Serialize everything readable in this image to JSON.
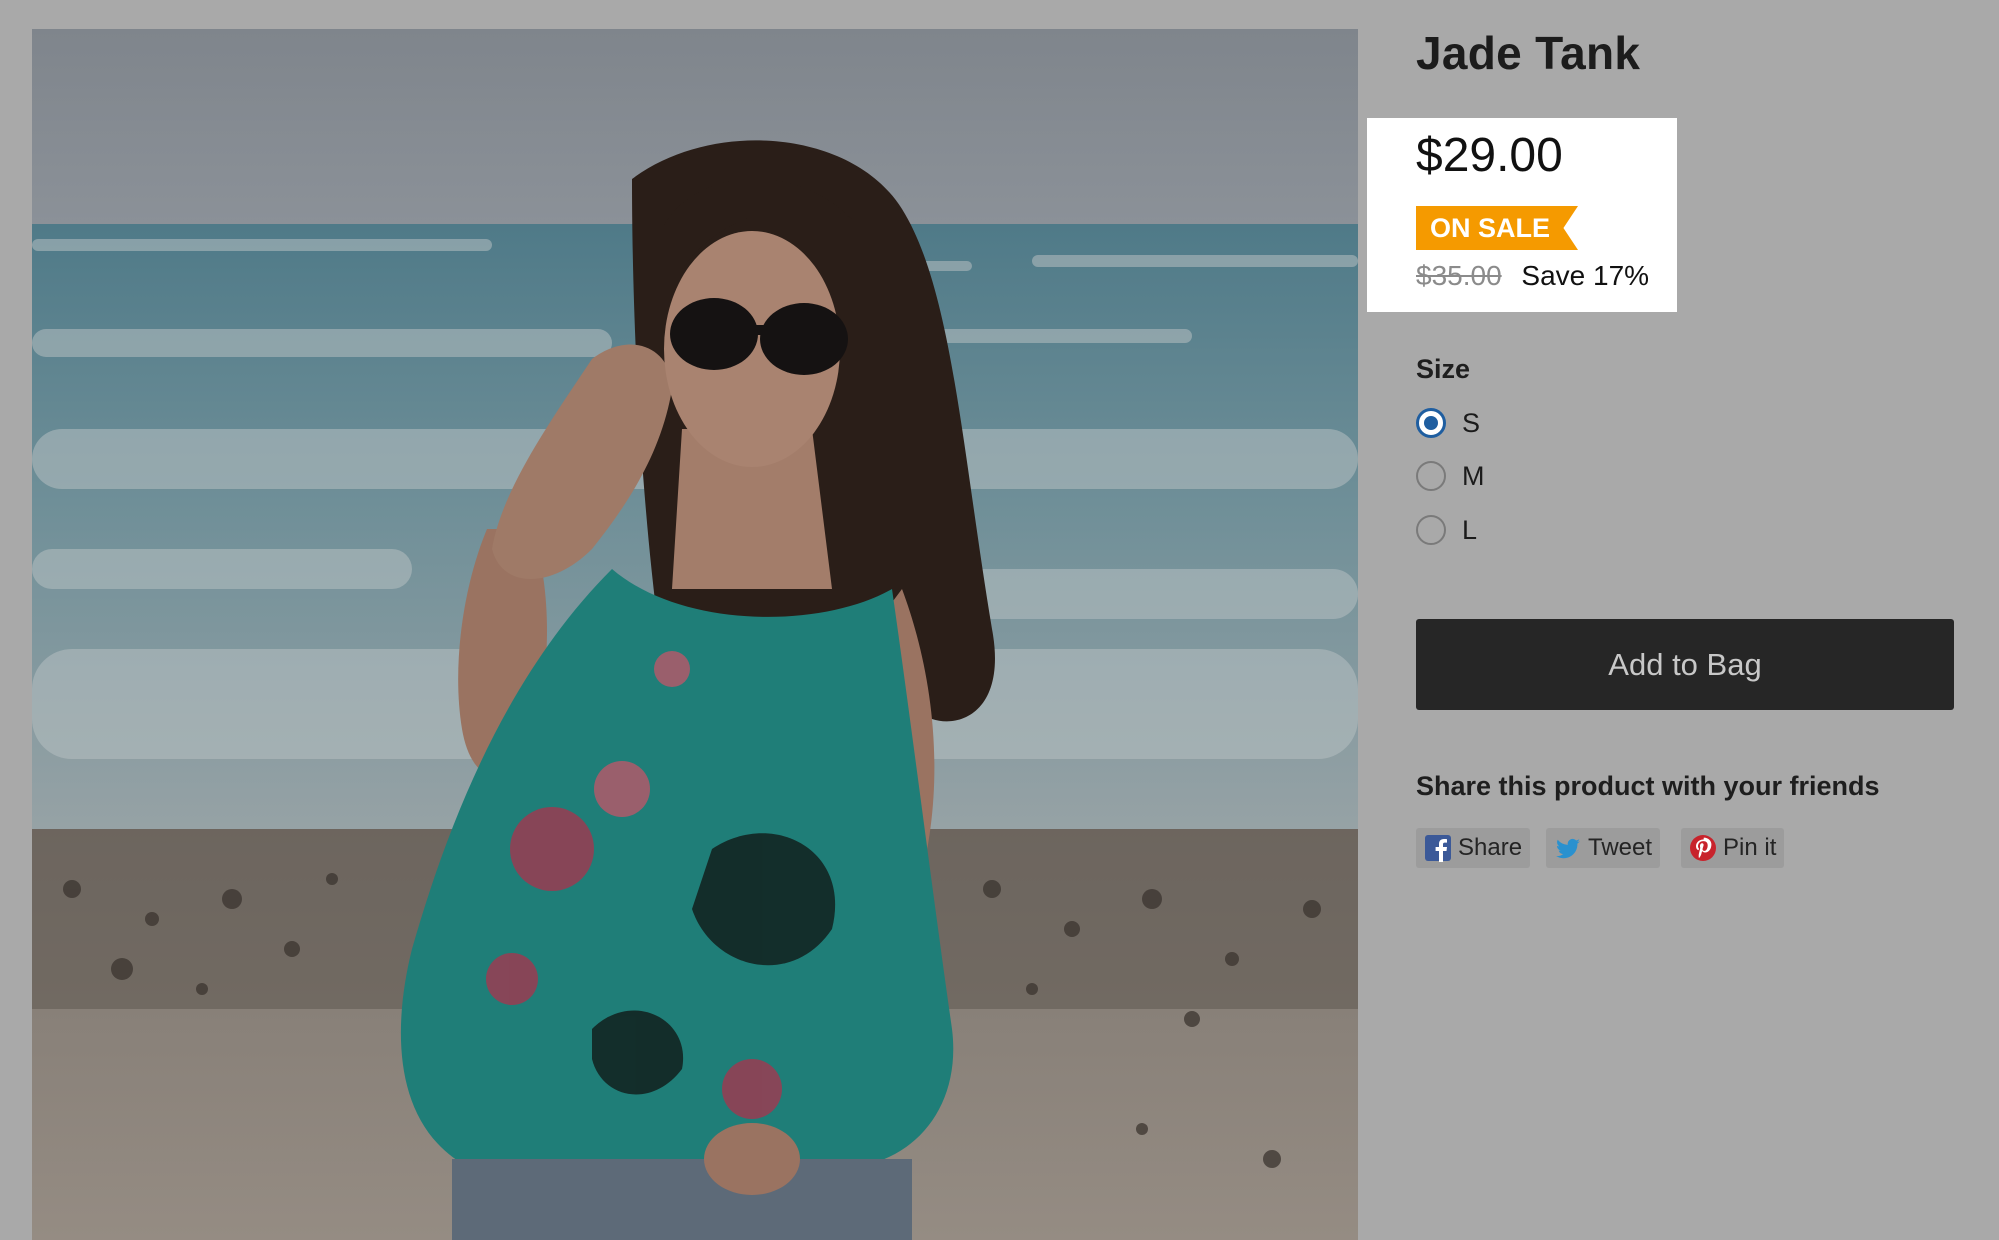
{
  "product": {
    "title": "Jade Tank",
    "image_description": "product-photo",
    "price": "$29.00",
    "badge": "ON SALE",
    "compare_price": "$35.00",
    "savings": "Save 17%"
  },
  "size": {
    "label": "Size",
    "options": [
      "S",
      "M",
      "L"
    ],
    "selected": "S"
  },
  "actions": {
    "add_to_bag": "Add to Bag"
  },
  "share": {
    "heading": "Share this product with your friends",
    "buttons": [
      {
        "label": "Share",
        "icon": "facebook-icon"
      },
      {
        "label": "Tweet",
        "icon": "twitter-icon"
      },
      {
        "label": "Pin it",
        "icon": "pinterest-icon"
      }
    ]
  },
  "colors": {
    "overlay": "#a9a9a9",
    "sale_badge": "#f59a00",
    "radio_selected": "#1f5ea0",
    "button_bg": "#262626",
    "facebook": "#3b5998",
    "twitter": "#2a91cf",
    "pinterest": "#c8232c"
  }
}
